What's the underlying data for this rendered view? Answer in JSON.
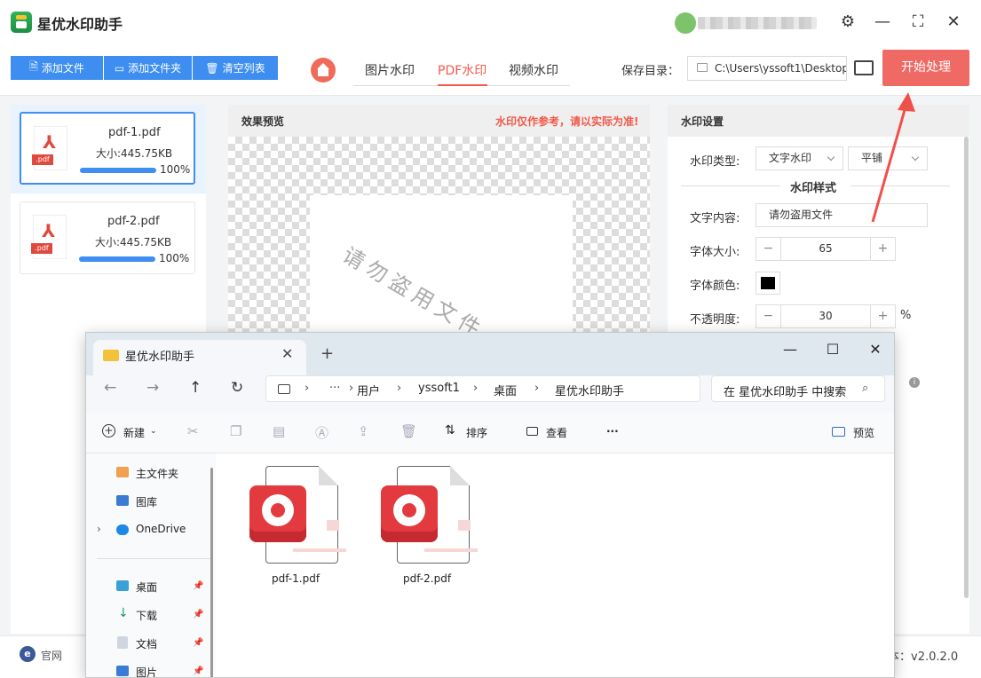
{
  "app": {
    "title": "星优水印助手",
    "window_controls": {
      "settings": "⚙",
      "minimize": "—",
      "maximize": "⛶",
      "close": "✕"
    }
  },
  "toolbar": {
    "add_file": "添加文件",
    "add_folder": "添加文件夹",
    "clear_list": "清空列表",
    "tabs": [
      "图片水印",
      "PDF水印",
      "视频水印"
    ],
    "active_tab": "PDF水印",
    "save_label": "保存目录：",
    "save_path": "C:\\Users\\yssoft1\\Desktop",
    "start": "开始处理"
  },
  "files": [
    {
      "name": "pdf-1.pdf",
      "size": "大小:445.75KB",
      "progress": "100%",
      "selected": true
    },
    {
      "name": "pdf-2.pdf",
      "size": "大小:445.75KB",
      "progress": "100%",
      "selected": false
    }
  ],
  "preview": {
    "title": "效果预览",
    "note": "水印仅作参考，请以实际为准!",
    "watermark_text": "请勿盗用文件"
  },
  "settings": {
    "title": "水印设置",
    "type_label": "水印类型:",
    "type_value": "文字水印",
    "layout_value": "平铺",
    "style_title": "水印样式",
    "text_label": "文字内容:",
    "text_value": "请勿盗用文件",
    "font_size_label": "字体大小:",
    "font_size_value": "65",
    "color_label": "字体颜色:",
    "color_value": "#000000",
    "opacity_label": "不透明度:",
    "opacity_value": "30",
    "opacity_unit": "%"
  },
  "status": {
    "site_label": "官网",
    "version": "本：v2.0.2.0"
  },
  "explorer": {
    "tab_title": "星优水印助手",
    "window_controls": {
      "minimize": "—",
      "maximize": "☐",
      "close": "✕"
    },
    "breadcrumb": [
      "用户",
      "yssoft1",
      "桌面",
      "星优水印助手"
    ],
    "search_placeholder": "在 星优水印助手 中搜索",
    "commands": {
      "new": "新建",
      "sort": "排序",
      "view": "查看",
      "more": "···",
      "preview": "预览"
    },
    "sidebar": [
      {
        "label": "主文件夹"
      },
      {
        "label": "图库"
      },
      {
        "label": "OneDrive"
      },
      {
        "label": "桌面"
      },
      {
        "label": "下载"
      },
      {
        "label": "文档"
      },
      {
        "label": "图片"
      }
    ],
    "files": [
      {
        "name": "pdf-1.pdf"
      },
      {
        "name": "pdf-2.pdf"
      }
    ]
  }
}
